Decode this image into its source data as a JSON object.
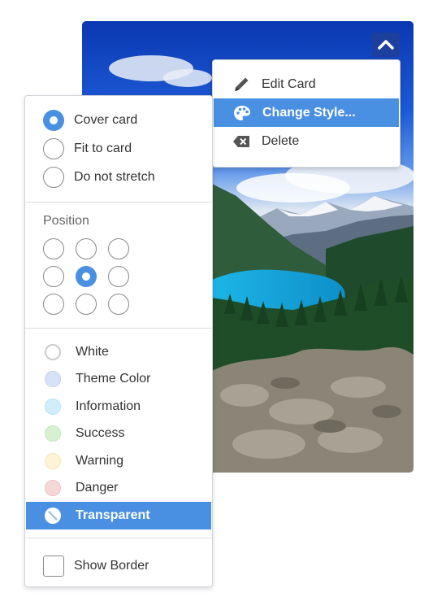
{
  "card": {
    "image": "mountain-lake-landscape",
    "collapse_icon": "chevron-up-icon"
  },
  "card_menu": {
    "items": [
      {
        "label": "Edit Card",
        "icon": "pencil-icon",
        "active": false
      },
      {
        "label": "Change Style...",
        "icon": "palette-icon",
        "active": true
      },
      {
        "label": "Delete",
        "icon": "delete-icon",
        "active": false
      }
    ]
  },
  "style_panel": {
    "fit_options": [
      {
        "label": "Cover card",
        "selected": true
      },
      {
        "label": "Fit to card",
        "selected": false
      },
      {
        "label": "Do not stretch",
        "selected": false
      }
    ],
    "position": {
      "title": "Position",
      "selected_index": 4
    },
    "colors": [
      {
        "label": "White",
        "swatch": "#ffffff",
        "ring": "#cccccc",
        "active": false
      },
      {
        "label": "Theme Color",
        "swatch": "#d6e2f5",
        "ring": "#c4d3ee",
        "active": false
      },
      {
        "label": "Information",
        "swatch": "#cfeefa",
        "ring": "#b9e3f4",
        "active": false
      },
      {
        "label": "Success",
        "swatch": "#d8f0d2",
        "ring": "#c5e6bd",
        "active": false
      },
      {
        "label": "Warning",
        "swatch": "#fdf3d6",
        "ring": "#f7e6b5",
        "active": false
      },
      {
        "label": "Danger",
        "swatch": "#f6d7d7",
        "ring": "#ecc2c2",
        "active": false
      },
      {
        "label": "Transparent",
        "swatch": "#ffffff",
        "ring": "#ffffff",
        "active": true
      }
    ],
    "show_border": {
      "label": "Show Border",
      "checked": false
    }
  },
  "colors": {
    "accent": "#4a90e2"
  }
}
